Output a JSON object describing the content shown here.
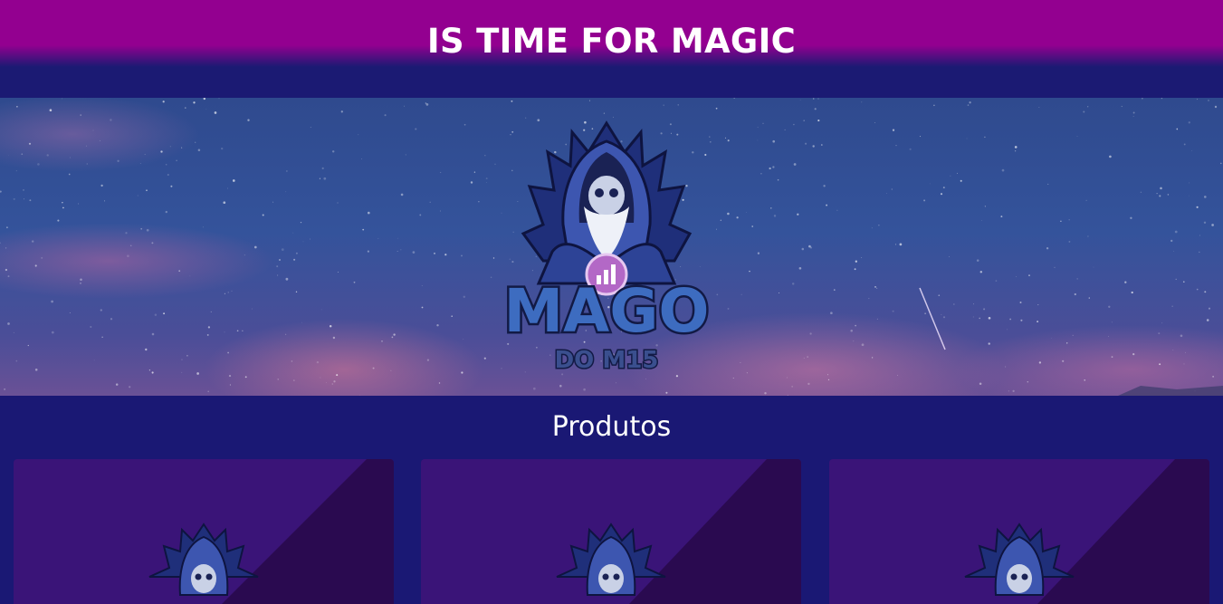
{
  "header": {
    "title": "IS TIME FOR MAGIC"
  },
  "banner": {
    "logo_icon": "wizard-logo-icon",
    "logo_text_main": "MAGO",
    "logo_text_sub": "DO M15"
  },
  "products": {
    "title": "Produtos",
    "cards": [
      {
        "image_icon": "wizard-logo-icon"
      },
      {
        "image_icon": "wizard-logo-icon"
      },
      {
        "image_icon": "wizard-logo-icon"
      }
    ]
  },
  "colors": {
    "header_top": "#930090",
    "page_bg": "#1a1874",
    "card_bg": "#3a1478",
    "card_diag": "#2a0a50"
  }
}
